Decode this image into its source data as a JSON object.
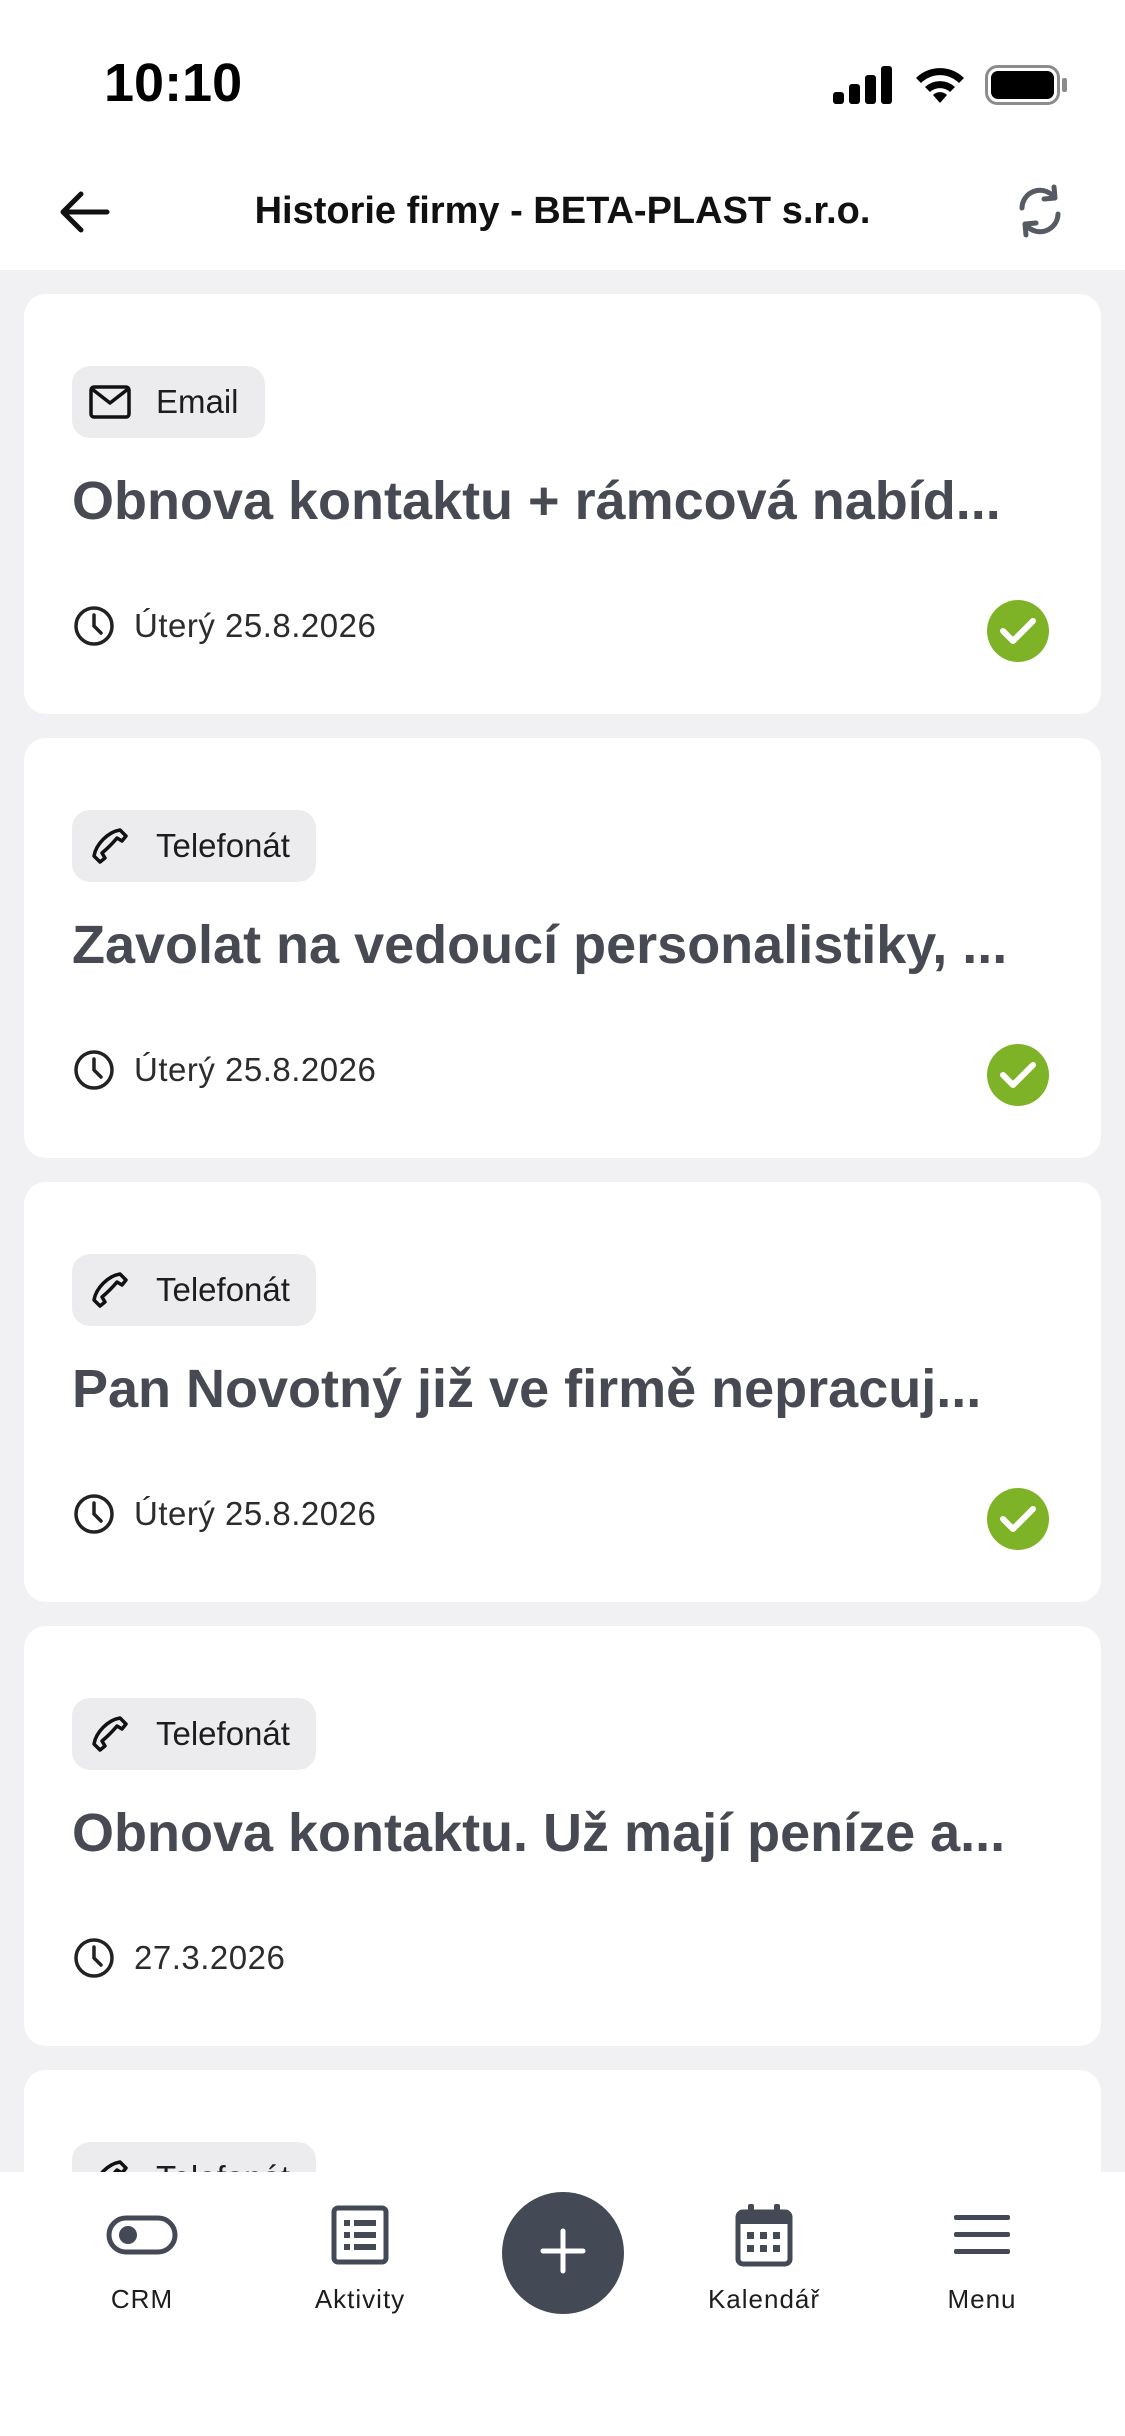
{
  "status_bar": {
    "time": "10:10",
    "icons": [
      "signal-icon",
      "wifi-icon",
      "battery-icon"
    ]
  },
  "header": {
    "title": "Historie firmy - BETA-PLAST s.r.o.",
    "back_icon": "arrow-left-icon",
    "refresh_icon": "refresh-icon"
  },
  "activities": [
    {
      "type": "Email",
      "type_icon": "envelope-icon",
      "title": "Obnova kontaktu + rámcová nabíd...",
      "date": "Úterý 25.8.2026",
      "done": true
    },
    {
      "type": "Telefonát",
      "type_icon": "phone-icon",
      "title": "Zavolat na vedoucí personalistiky, ...",
      "date": "Úterý 25.8.2026",
      "done": true
    },
    {
      "type": "Telefonát",
      "type_icon": "phone-icon",
      "title": "Pan Novotný již ve firmě nepracuj...",
      "date": "Úterý 25.8.2026",
      "done": true
    },
    {
      "type": "Telefonát",
      "type_icon": "phone-icon",
      "title": "Obnova kontaktu. Už mají peníze a...",
      "date": "27.3.2026",
      "done": false
    },
    {
      "type": "Telefonát",
      "type_icon": "phone-icon",
      "title": "",
      "date": "",
      "done": false
    }
  ],
  "bottom_nav": {
    "items": [
      {
        "label": "CRM",
        "icon": "toggle-icon"
      },
      {
        "label": "Aktivity",
        "icon": "list-icon"
      },
      {
        "label": "",
        "icon": "plus-icon"
      },
      {
        "label": "Kalendář",
        "icon": "calendar-icon"
      },
      {
        "label": "Menu",
        "icon": "menu-icon"
      }
    ]
  },
  "colors": {
    "done": "#7fb327",
    "fab": "#434a55",
    "title_text": "#474a52",
    "background": "#f1f1f3"
  }
}
